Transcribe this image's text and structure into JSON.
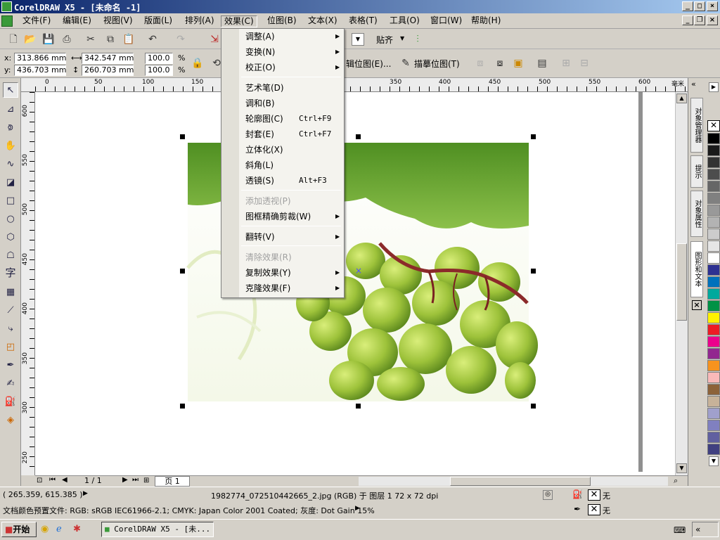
{
  "window": {
    "title": "CorelDRAW X5 - [未命名 -1]"
  },
  "menubar": [
    "文件(F)",
    "编辑(E)",
    "视图(V)",
    "版面(L)",
    "排列(A)",
    "效果(C)",
    "位图(B)",
    "文本(X)",
    "表格(T)",
    "工具(O)",
    "窗口(W)",
    "帮助(H)"
  ],
  "toolbar": {
    "snap_label": "贴齐"
  },
  "propbar": {
    "x_label": "x:",
    "x_value": "313.866 mm",
    "y_label": "y:",
    "y_value": "436.703 mm",
    "w_value": "342.547 mm",
    "h_value": "260.703 mm",
    "scale_x": "100.0",
    "scale_y": "100.0",
    "pct": "%",
    "edit_bitmap": "辑位图(E)...",
    "trace_bitmap": "描摹位图(T)"
  },
  "rulers": {
    "h_ticks": [
      "0",
      "50",
      "100",
      "150",
      "350",
      "400",
      "450",
      "500",
      "550",
      "600"
    ],
    "h_unit": "毫米",
    "v_ticks": [
      "600",
      "550",
      "500",
      "450",
      "400",
      "350",
      "300",
      "250"
    ]
  },
  "effects_menu": {
    "items": [
      {
        "label": "调整(A)",
        "shortcut": "",
        "submenu": true,
        "disabled": false
      },
      {
        "label": "变换(N)",
        "shortcut": "",
        "submenu": true,
        "disabled": false
      },
      {
        "label": "校正(O)",
        "shortcut": "",
        "submenu": true,
        "disabled": false
      },
      {
        "label": "艺术笔(D)",
        "shortcut": "",
        "submenu": false,
        "disabled": false
      },
      {
        "label": "调和(B)",
        "shortcut": "",
        "submenu": false,
        "disabled": false
      },
      {
        "label": "轮廓图(C)",
        "shortcut": "Ctrl+F9",
        "submenu": false,
        "disabled": false
      },
      {
        "label": "封套(E)",
        "shortcut": "Ctrl+F7",
        "submenu": false,
        "disabled": false
      },
      {
        "label": "立体化(X)",
        "shortcut": "",
        "submenu": false,
        "disabled": false
      },
      {
        "label": "斜角(L)",
        "shortcut": "",
        "submenu": false,
        "disabled": false
      },
      {
        "label": "透镜(S)",
        "shortcut": "Alt+F3",
        "submenu": false,
        "disabled": false
      },
      {
        "label": "添加透视(P)",
        "shortcut": "",
        "submenu": false,
        "disabled": true
      },
      {
        "label": "图框精确剪裁(W)",
        "shortcut": "",
        "submenu": true,
        "disabled": false
      },
      {
        "label": "翻转(V)",
        "shortcut": "",
        "submenu": true,
        "disabled": false
      },
      {
        "label": "清除效果(R)",
        "shortcut": "",
        "submenu": false,
        "disabled": true
      },
      {
        "label": "复制效果(Y)",
        "shortcut": "",
        "submenu": true,
        "disabled": false
      },
      {
        "label": "克隆效果(F)",
        "shortcut": "",
        "submenu": true,
        "disabled": false
      }
    ]
  },
  "toolbox": {
    "text_tool": "字"
  },
  "docker": {
    "tabs": [
      "对象管理器",
      "提示",
      "对象属性",
      "图形和文本"
    ]
  },
  "palette": {
    "colors": [
      "#000000",
      "#1a1a1a",
      "#333333",
      "#4d4d4d",
      "#666666",
      "#808080",
      "#999999",
      "#b3b3b3",
      "#cccccc",
      "#e6e6e6",
      "#ffffff",
      "#2e3192",
      "#0071bc",
      "#00a99d",
      "#009245",
      "#fff200",
      "#ed1c24",
      "#ec008c",
      "#92278f",
      "#f7931e",
      "#f9b9b9",
      "#8c6239",
      "#c7b299",
      "#a0a0cc",
      "#8080c0",
      "#6060a0",
      "#404080"
    ]
  },
  "navbar": {
    "page_counter": "1 / 1",
    "page_tab": "页 1"
  },
  "statusbar": {
    "coords": "( 265.359, 615.385 )",
    "object_info": "1982774_072510442665_2.jpg (RGB) 于 图层 1 72 x 72 dpi",
    "color_profile": "文档颜色预置文件: RGB: sRGB IEC61966-2.1; CMYK: Japan Color 2001 Coated; 灰度: Dot Gain 15%",
    "fill_none": "无",
    "outline_none": "无"
  },
  "taskbar": {
    "start": "开始",
    "task": "CorelDRAW X5 - [未..."
  }
}
